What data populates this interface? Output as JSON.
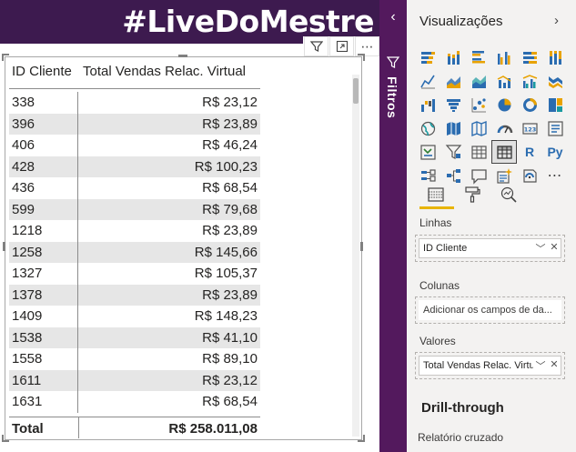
{
  "banner": {
    "text": "#LiveDoMestre"
  },
  "table": {
    "columns": [
      "ID Cliente",
      "Total Vendas Relac. Virtual"
    ],
    "rows": [
      [
        "338",
        "R$ 23,12"
      ],
      [
        "396",
        "R$ 23,89"
      ],
      [
        "406",
        "R$ 46,24"
      ],
      [
        "428",
        "R$ 100,23"
      ],
      [
        "436",
        "R$ 68,54"
      ],
      [
        "599",
        "R$ 79,68"
      ],
      [
        "1218",
        "R$ 23,89"
      ],
      [
        "1258",
        "R$ 145,66"
      ],
      [
        "1327",
        "R$ 105,37"
      ],
      [
        "1378",
        "R$ 23,89"
      ],
      [
        "1409",
        "R$ 148,23"
      ],
      [
        "1538",
        "R$ 41,10"
      ],
      [
        "1558",
        "R$ 89,10"
      ],
      [
        "1611",
        "R$ 23,12"
      ],
      [
        "1631",
        "R$ 68,54"
      ]
    ],
    "total_label": "Total",
    "total_value": "R$ 258.011,08"
  },
  "visual_header": {
    "more": "⋯"
  },
  "filters": {
    "label": "Filtros",
    "chevron": "‹"
  },
  "visualizations": {
    "title": "Visualizações",
    "chevron": "›",
    "icons": [
      "stacked-bar-icon",
      "stacked-column-icon",
      "clustered-bar-icon",
      "clustered-column-icon",
      "100-bar-icon",
      "100-column-icon",
      "line-chart-icon",
      "area-chart-icon",
      "stacked-area-icon",
      "line-column-icon",
      "line-clustered-icon",
      "ribbon-chart-icon",
      "waterfall-icon",
      "funnel-icon",
      "scatter-icon",
      "pie-icon",
      "donut-icon",
      "treemap-icon",
      "map-icon",
      "filled-map-icon",
      "shape-map-icon",
      "gauge-icon",
      "card-icon",
      "multirow-card-icon",
      "kpi-icon",
      "slicer-icon",
      "table-icon",
      "matrix-icon",
      "r-visual-icon",
      "python-visual-icon",
      "key-influencers-icon",
      "decomposition-tree-icon",
      "qa-icon",
      "smart-narrative-icon",
      "paginated-icon",
      "more-visuals-icon"
    ],
    "r_text": "R",
    "py_text": "Py",
    "more_text": "⋯",
    "tabs": [
      "fields-tab-icon",
      "format-tab-icon",
      "analytics-tab-icon"
    ],
    "wells": {
      "rows_label": "Linhas",
      "rows_field": "ID Cliente",
      "columns_label": "Colunas",
      "columns_placeholder": "Adicionar os campos de da...",
      "values_label": "Valores",
      "values_field": "Total Vendas Relac. Virtual"
    },
    "drill_title": "Drill-through",
    "drill_sub": "Relatório cruzado"
  },
  "colors": {
    "banner": "#3d1a4f",
    "filters": "#53195d",
    "pane": "#f3f2f1",
    "accent": "#e8b400",
    "row_stripe": "#e6e6e6"
  }
}
